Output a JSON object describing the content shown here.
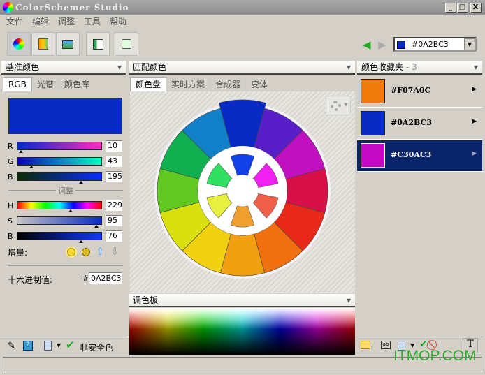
{
  "window": {
    "title": "ColorSchemer Studio",
    "min": "_",
    "max": "□",
    "close": "X"
  },
  "menu": [
    "文件",
    "编辑",
    "调整",
    "工具",
    "帮助"
  ],
  "toolbar": {
    "icons": [
      "color-mixer-icon",
      "gradient-import-icon",
      "image-picker-icon",
      "layout-preview-icon",
      "export-icon"
    ]
  },
  "nav": {
    "current_color": "#0A2BC3",
    "current_hex": "#0A2BC3"
  },
  "left": {
    "header": "基准颜色",
    "tabs": [
      "RGB",
      "光谱",
      "颜色库"
    ],
    "base_color": "#0A2BC3",
    "rgb": [
      {
        "label": "R",
        "value": "10"
      },
      {
        "label": "G",
        "value": "43"
      },
      {
        "label": "B",
        "value": "195"
      }
    ],
    "adjust_label": "调整",
    "hsb": [
      {
        "label": "H",
        "value": "229"
      },
      {
        "label": "S",
        "value": "95"
      },
      {
        "label": "B",
        "value": "76"
      }
    ],
    "increment_label": "增量:",
    "hex_label": "十六进制值:",
    "hex_prefix": "#",
    "hex_value": "0A2BC3",
    "bottom": {
      "safe_label": "非安全色"
    }
  },
  "middle": {
    "header": "匹配颜色",
    "tabs": [
      "颜色盘",
      "实时方案",
      "合成器",
      "变体"
    ],
    "wheel": {
      "outer": [
        "#0A2BC3",
        "#5A1EC8",
        "#C010C0",
        "#D8104A",
        "#E82818",
        "#F07010",
        "#F0A010",
        "#F0D010",
        "#D8E010",
        "#60C820",
        "#10B050",
        "#1080C8"
      ],
      "inner": [
        "#1040E8",
        "#F020F0",
        "#F06048",
        "#F0A030",
        "#E8F040",
        "#30E060"
      ]
    },
    "palette_header": "调色板"
  },
  "right": {
    "header": "颜色收藏夹",
    "count": "- 3",
    "items": [
      {
        "color": "#F07A0C",
        "label": "#F07A0C"
      },
      {
        "color": "#0A2BC3",
        "label": "#0A2BC3"
      },
      {
        "color": "#C30AC3",
        "label": "#C30AC3",
        "selected": true
      }
    ]
  },
  "watermark": "ITMOP.COM"
}
